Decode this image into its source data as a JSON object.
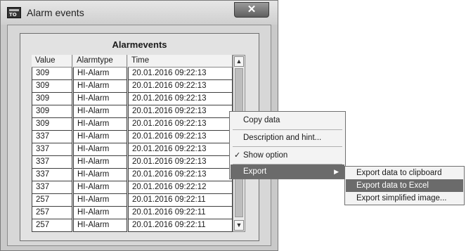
{
  "window": {
    "title": "Alarm events",
    "app_icon_text": "TO",
    "close_label": "✕"
  },
  "grid": {
    "title": "Alarmevents",
    "columns": [
      "Value",
      "Alarmtype",
      "Time"
    ],
    "rows": [
      [
        "309",
        "HI-Alarm",
        "20.01.2016 09:22:13"
      ],
      [
        "309",
        "HI-Alarm",
        "20.01.2016 09:22:13"
      ],
      [
        "309",
        "HI-Alarm",
        "20.01.2016 09:22:13"
      ],
      [
        "309",
        "HI-Alarm",
        "20.01.2016 09:22:13"
      ],
      [
        "309",
        "HI-Alarm",
        "20.01.2016 09:22:13"
      ],
      [
        "337",
        "HI-Alarm",
        "20.01.2016 09:22:13"
      ],
      [
        "337",
        "HI-Alarm",
        "20.01.2016 09:22:13"
      ],
      [
        "337",
        "HI-Alarm",
        "20.01.2016 09:22:13"
      ],
      [
        "337",
        "HI-Alarm",
        "20.01.2016 09:22:13"
      ],
      [
        "337",
        "HI-Alarm",
        "20.01.2016 09:22:12"
      ],
      [
        "257",
        "HI-Alarm",
        "20.01.2016 09:22:11"
      ],
      [
        "257",
        "HI-Alarm",
        "20.01.2016 09:22:11"
      ],
      [
        "257",
        "HI-Alarm",
        "20.01.2016 09:22:11"
      ]
    ],
    "scroll_up_icon": "triangle-up-icon",
    "scroll_down_icon": "triangle-down-icon"
  },
  "context_menu": {
    "items": [
      {
        "label": "Copy data"
      },
      {
        "label": "Description and hint..."
      },
      {
        "label": "Show option",
        "checked": true
      },
      {
        "label": "Export",
        "has_submenu": true,
        "highlighted": true
      }
    ],
    "check_glyph": "✓",
    "submenu_arrow": "▶"
  },
  "export_submenu": {
    "items": [
      {
        "label": "Export data to clipboard"
      },
      {
        "label": "Export data to Excel",
        "highlighted": true
      },
      {
        "label": "Export simplified image..."
      }
    ]
  },
  "colors": {
    "highlight": "#6b6b6b",
    "window_bg": "#c9c9c9"
  }
}
